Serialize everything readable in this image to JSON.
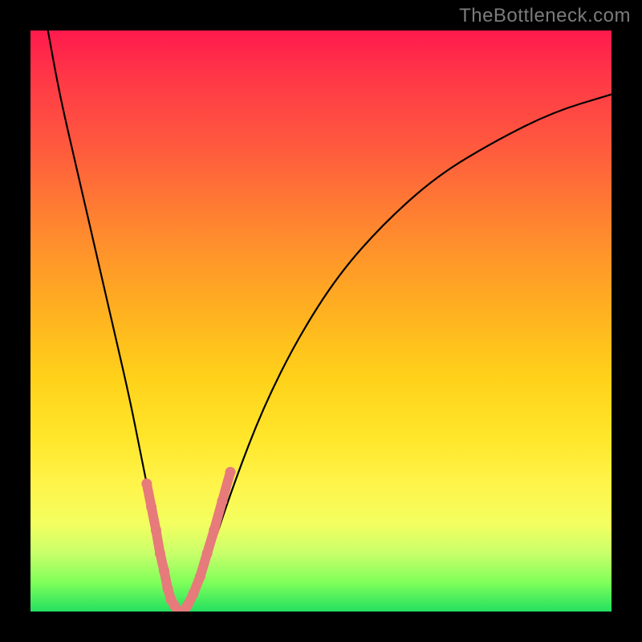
{
  "watermark": "TheBottleneck.com",
  "colors": {
    "background": "#000000",
    "gradient_top": "#ff1a4d",
    "gradient_mid1": "#ff8a2e",
    "gradient_mid2": "#ffe62a",
    "gradient_bottom": "#24e060",
    "curve": "#000000",
    "marker": "#e77a7a"
  },
  "chart_data": {
    "type": "line",
    "title": "",
    "xlabel": "",
    "ylabel": "",
    "xlim": [
      0,
      100
    ],
    "ylim": [
      0,
      100
    ],
    "note": "Axes are unlabeled; values are normalized percentages estimated from pixel position. y = bottleneck severity (0 = green/ideal, 100 = red/worst).",
    "series": [
      {
        "name": "bottleneck-curve",
        "x": [
          3,
          5,
          8,
          11,
          14,
          17,
          19,
          21,
          23,
          24.5,
          26,
          28,
          31,
          35,
          40,
          46,
          53,
          61,
          70,
          80,
          90,
          100
        ],
        "y": [
          100,
          89,
          76,
          63,
          50,
          37,
          27,
          17,
          8,
          2,
          0,
          2,
          10,
          22,
          35,
          47,
          58,
          67,
          75,
          81,
          86,
          89
        ]
      }
    ],
    "markers": {
      "name": "highlighted-points",
      "note": "Salmon markers/segments clustered near the curve's minimum on both branches.",
      "x": [
        20.0,
        20.8,
        21.6,
        22.3,
        23.0,
        23.6,
        24.2,
        24.8,
        25.4,
        26.2,
        27.0,
        28.0,
        29.2,
        30.4,
        31.6,
        33.0,
        34.4
      ],
      "y": [
        22,
        18,
        14,
        10,
        7,
        4,
        2,
        1,
        0,
        0,
        1,
        3,
        6,
        10,
        14,
        19,
        24
      ]
    }
  }
}
